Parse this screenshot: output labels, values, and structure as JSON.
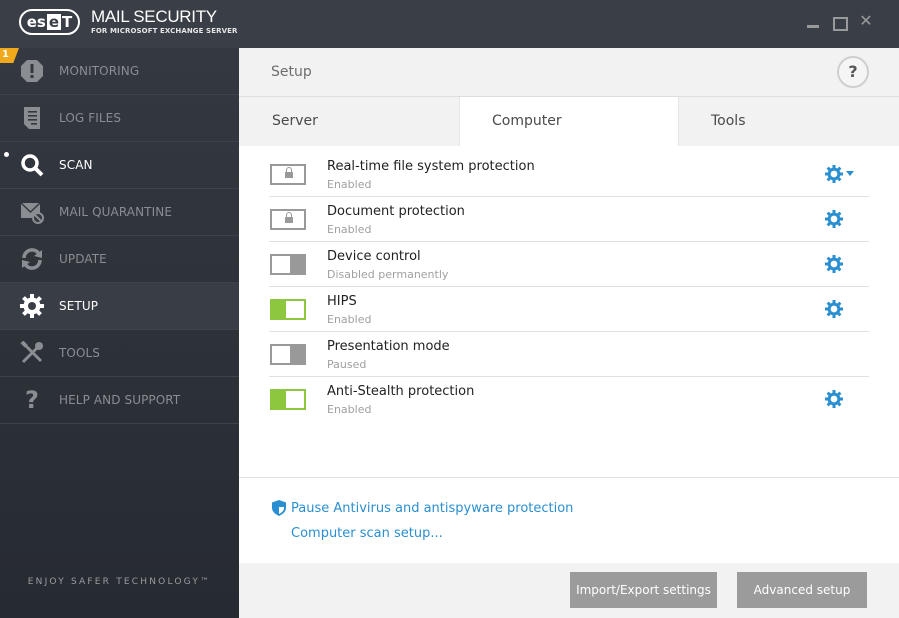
{
  "app": {
    "logo": "eset",
    "title": "MAIL SECURITY",
    "subtitle": "FOR MICROSOFT EXCHANGE SERVER",
    "window_controls": [
      "minimize",
      "maximize",
      "close"
    ]
  },
  "sidebar": {
    "items": [
      {
        "label": "MONITORING",
        "icon": "alert-octagon-icon",
        "badge": "1"
      },
      {
        "label": "LOG FILES",
        "icon": "document-icon"
      },
      {
        "label": "SCAN",
        "icon": "magnifier-icon",
        "indicator": true
      },
      {
        "label": "MAIL QUARANTINE",
        "icon": "mail-blocked-icon"
      },
      {
        "label": "UPDATE",
        "icon": "refresh-icon"
      },
      {
        "label": "SETUP",
        "icon": "gear-icon",
        "active": true
      },
      {
        "label": "TOOLS",
        "icon": "wrench-screwdriver-icon"
      },
      {
        "label": "HELP AND SUPPORT",
        "icon": "question-icon"
      }
    ],
    "tagline": "ENJOY SAFER TECHNOLOGY™"
  },
  "main": {
    "title": "Setup",
    "help_label": "?",
    "tabs": [
      {
        "label": "Server"
      },
      {
        "label": "Computer",
        "active": true
      },
      {
        "label": "Tools"
      }
    ],
    "features": [
      {
        "title": "Real-time file system protection",
        "status": "Enabled",
        "toggle": "locked",
        "settings": true,
        "dropdown": true
      },
      {
        "title": "Document protection",
        "status": "Enabled",
        "toggle": "locked",
        "settings": true
      },
      {
        "title": "Device control",
        "status": "Disabled permanently",
        "toggle": "off",
        "settings": true
      },
      {
        "title": "HIPS",
        "status": "Enabled",
        "toggle": "on",
        "settings": true
      },
      {
        "title": "Presentation mode",
        "status": "Paused",
        "toggle": "off",
        "settings": false
      },
      {
        "title": "Anti-Stealth protection",
        "status": "Enabled",
        "toggle": "on",
        "settings": true
      }
    ],
    "links": {
      "pause": "Pause Antivirus and antispyware protection",
      "scan_setup": "Computer scan setup..."
    },
    "buttons": {
      "import_export": "Import/Export settings",
      "advanced": "Advanced setup"
    }
  },
  "colors": {
    "accent": "#2a8fd0",
    "toggle_on": "#8dc63f",
    "toggle_off": "#999999",
    "badge": "#f0a91b",
    "titlebar": "#3a3e46"
  }
}
